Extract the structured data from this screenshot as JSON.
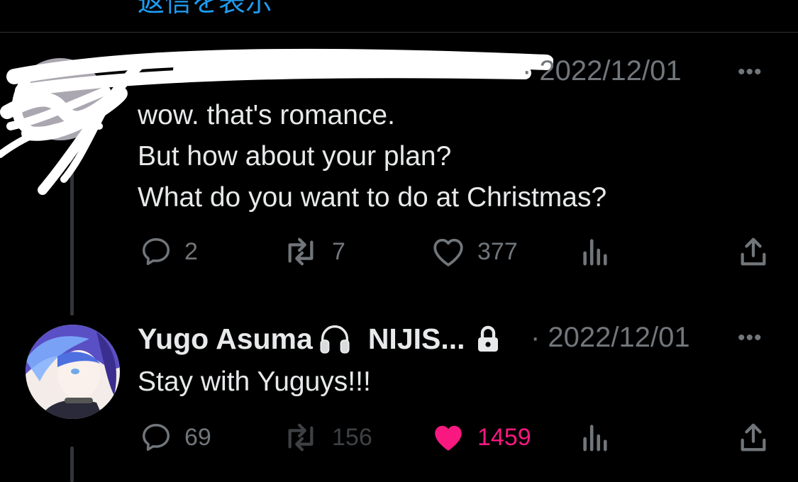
{
  "top": {
    "link_text": "返信を表示"
  },
  "reply1": {
    "timestamp": "· 2022/12/01",
    "more": "•••",
    "lines": "wow. that's romance.\nBut how about your plan?\nWhat do you want to do at Christmas?",
    "actions": {
      "replies": "2",
      "retweets": "7",
      "likes": "377"
    }
  },
  "reply2": {
    "author_name": "Yugo Asuma",
    "author_handle": "NIJIS...",
    "timestamp": "· 2022/12/01",
    "more": "•••",
    "text": "Stay with Yuguys!!!",
    "actions": {
      "replies": "69",
      "retweets": "156",
      "likes": "1459"
    },
    "liked": true
  },
  "colors": {
    "background": "#000000",
    "text": "#e7e9ea",
    "muted": "#71767b",
    "like": "#f91880",
    "link": "#1d9bf0"
  },
  "icons": [
    "reply-icon",
    "retweet-icon",
    "heart-icon",
    "views-icon",
    "share-icon",
    "headphones-icon",
    "lock-icon",
    "more-icon"
  ]
}
